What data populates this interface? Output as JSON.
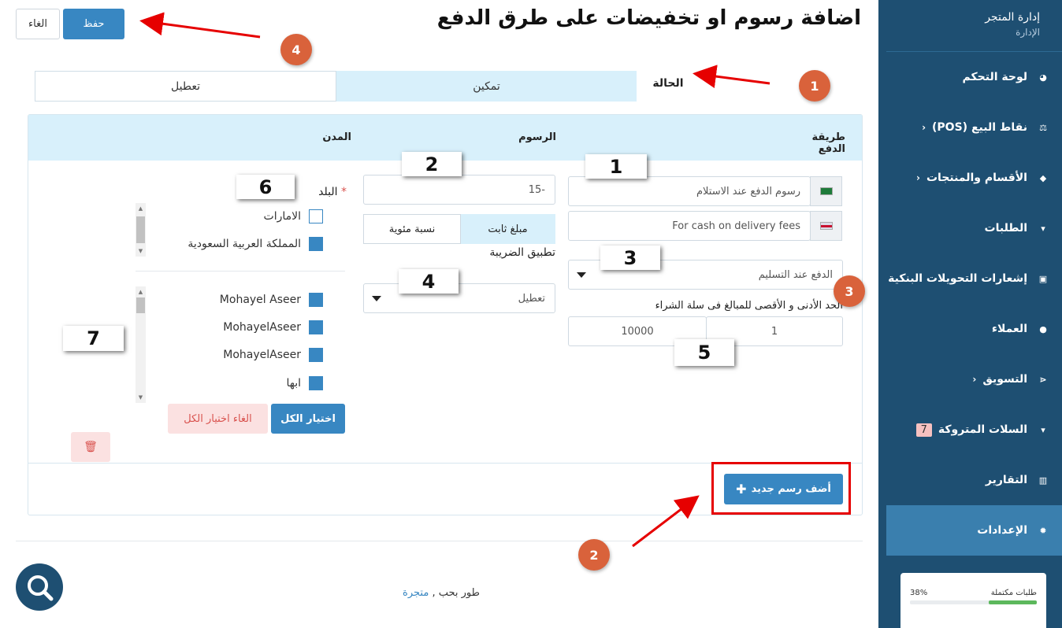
{
  "header": {
    "title": "اضافة رسوم او تخفيضات على طرق الدفع",
    "save_label": "حفظ",
    "cancel_label": "الغاء"
  },
  "status": {
    "label": "الحالة",
    "enable": "تمكين",
    "disable": "تعطيل"
  },
  "table_headers": {
    "payment_method": "طريقة الدفع",
    "fees": "الرسوم",
    "cities": "المدن"
  },
  "fee_names": {
    "ar": "رسوم الدفع عند الاستلام",
    "en": "For cash on delivery fees"
  },
  "payment_method_selected": "الدفع عند التسليم",
  "min_max": {
    "label": "الحد الأدنى و الأقصى للمبالغ فى سلة الشراء",
    "min": "1",
    "max": "10000"
  },
  "fee_value": "-15",
  "fee_type": {
    "fixed": "مبلغ ثابت",
    "percent": "نسبة مئوية"
  },
  "tax": {
    "label": "تطبيق الضريبة",
    "selected": "تعطيل"
  },
  "country": {
    "label": "البلد",
    "required_mark": "*",
    "items": [
      {
        "name": "الامارات",
        "checked": false
      },
      {
        "name": "المملكة العربية السعودية",
        "checked": true
      }
    ]
  },
  "cities_list": [
    {
      "name": "Mohayel Aseer",
      "checked": true
    },
    {
      "name": "MohayelAseer",
      "checked": true
    },
    {
      "name": "MohayelAseer",
      "checked": true
    },
    {
      "name": "ابها",
      "checked": true
    }
  ],
  "actions": {
    "select_all": "اختيار الكل",
    "clear_all": "الغاء اختيار الكل",
    "add_fee": "أضف رسم جديد",
    "add_icon": "plus-icon",
    "trash_icon": "trash-icon"
  },
  "footer": {
    "text": "طور بحب ,",
    "brand": "متجرة"
  },
  "sidebar": {
    "store_title": "إدارة المتجر",
    "store_sub": "الإدارة",
    "items": [
      {
        "label": "لوحة التحكم",
        "icon": "dashboard-icon",
        "chevron": false
      },
      {
        "label": "نقاط البيع (POS)",
        "icon": "scale-icon",
        "chevron": true
      },
      {
        "label": "الأقسام والمنتجات",
        "icon": "tag-icon",
        "chevron": true
      },
      {
        "label": "الطلبات",
        "icon": "cart-icon",
        "chevron": false
      },
      {
        "label": "إشعارات التحويلات البنكية",
        "icon": "money-icon",
        "chevron": false
      },
      {
        "label": "العملاء",
        "icon": "user-icon",
        "chevron": false
      },
      {
        "label": "التسويق",
        "icon": "share-icon",
        "chevron": true
      },
      {
        "label": "السلات المتروكة",
        "icon": "cart-icon",
        "chevron": false,
        "badge": "7"
      },
      {
        "label": "التقارير",
        "icon": "bar-chart-icon",
        "chevron": false
      },
      {
        "label": "الإعدادات",
        "icon": "gear-icon",
        "chevron": false,
        "active": true
      }
    ],
    "card": {
      "label": "طلبات مكتملة",
      "percent_text": "38%",
      "progress": 0.38,
      "bar_color": "#5cb85c"
    }
  },
  "annotations": {
    "boxes": [
      "1",
      "2",
      "3",
      "4",
      "5",
      "6",
      "7"
    ],
    "circles": [
      "1",
      "2",
      "3",
      "4"
    ]
  },
  "colors": {
    "primary": "#3887c2",
    "sidebar": "#1e4f72",
    "header_bg": "#d8f0fb",
    "danger_bg": "#fbe1e1",
    "annotation": "#d9623b",
    "arrow": "#e60000"
  }
}
